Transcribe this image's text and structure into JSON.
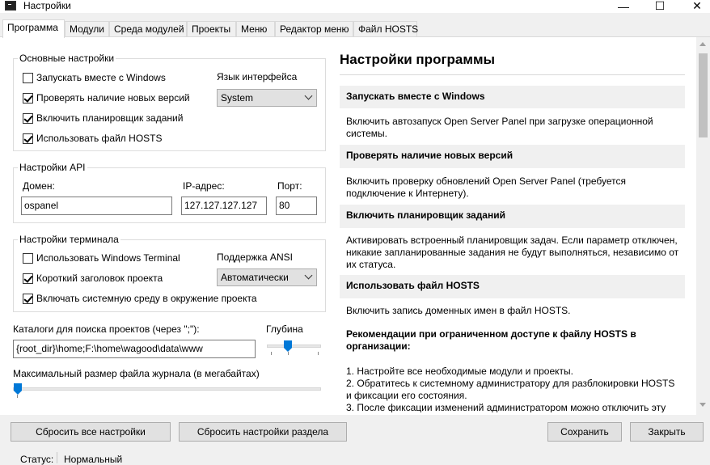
{
  "window": {
    "title": "Настройки",
    "minimize": "—",
    "maximize": "☐",
    "close": "✕"
  },
  "tabs": [
    "Программа",
    "Модули",
    "Среда модулей",
    "Проекты",
    "Меню",
    "Редактор меню",
    "Файл HOSTS"
  ],
  "basic": {
    "title": "Основные настройки",
    "autostart": "Запускать вместе с Windows",
    "check_updates": "Проверять наличие новых версий",
    "scheduler": "Включить планировщик заданий",
    "use_hosts": "Использовать файл HOSTS",
    "language_label": "Язык интерфейса",
    "language_value": "System"
  },
  "api": {
    "title": "Настройки API",
    "domain_label": "Домен:",
    "domain_value": "ospanel",
    "ip_label": "IP-адрес:",
    "ip_value": "127.127.127.127",
    "port_label": "Порт:",
    "port_value": "80"
  },
  "terminal": {
    "title": "Настройки терминала",
    "windows_terminal": "Использовать Windows Terminal",
    "short_header": "Короткий заголовок проекта",
    "system_env": "Включать системную среду в окружение проекта",
    "ansi_label": "Поддержка ANSI",
    "ansi_value": "Автоматически"
  },
  "search": {
    "label": "Каталоги для поиска проектов (через \";\"):",
    "value": "{root_dir}\\home;F:\\home\\wagood\\data\\www",
    "depth_label": "Глубина"
  },
  "log": {
    "label": "Максимальный размер файла журнала (в мегабайтах)"
  },
  "help": {
    "title": "Настройки программы",
    "sections": [
      {
        "head": "Запускать вместе с Windows",
        "text": "Включить автозапуск Open Server Panel при загрузке операционной системы."
      },
      {
        "head": "Проверять наличие новых версий",
        "text": "Включить проверку обновлений Open Server Panel (требуется подключение к Интернету)."
      },
      {
        "head": "Включить планировщик заданий",
        "text": "Активировать встроенный планировщик задач. Если параметр отключен, никакие запланированные задания не будут выполняться, независимо от их статуса."
      },
      {
        "head": "Использовать файл HOSTS",
        "text": "Включить запись доменных имен в файл HOSTS."
      }
    ],
    "recommend_head": "Рекомендации при ограниченном доступе к файлу HOSTS в организации:",
    "steps": [
      "1. Настройте все необходимые модули и проекты.",
      "2. Обратитесь к системному администратору для разблокировки HOSTS и фиксации его состояния.",
      "3. После фиксации изменений администратором можно отключить эту"
    ]
  },
  "buttons": {
    "reset_all": "Сбросить все настройки",
    "reset_section": "Сбросить настройки раздела",
    "save": "Сохранить",
    "close": "Закрыть"
  },
  "status": {
    "label": "Статус:",
    "value": "Нормальный"
  }
}
